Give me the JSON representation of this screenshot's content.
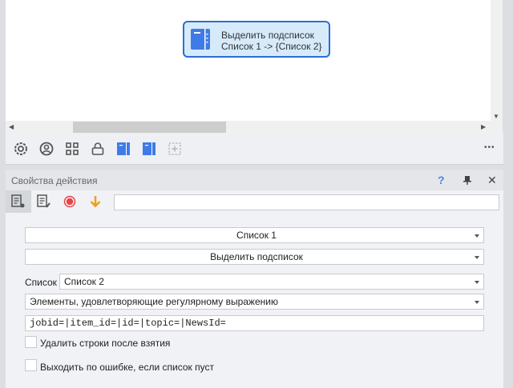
{
  "canvas": {
    "node": {
      "title": "Выделить подсписок",
      "subtitle": "Список 1 -> {Список 2}",
      "color": "#2a6fd4"
    }
  },
  "toolbar": {
    "icons": [
      "gear-icon",
      "user-circle-icon",
      "grid-icon",
      "lock-icon",
      "notebook-icon",
      "notebook-icon",
      "add-dashed-icon"
    ],
    "more": "•••"
  },
  "panel": {
    "title": "Свойства действия",
    "help": "?",
    "pin": "pin-icon",
    "close": "✕",
    "tabs": [
      "properties-icon",
      "edit-icon",
      "record-icon",
      "arrow-down-icon"
    ],
    "search_value": "",
    "source_list": "Список 1",
    "action": "Выделить подсписок",
    "target_label": "Список",
    "target_list": "Список 2",
    "mode": "Элементы, удовлетворяющие регулярному выражению",
    "regex": "jobid=|item_id=|id=|topic=|NewsId=",
    "delete_rows": {
      "label": "Удалить строки после взятия",
      "checked": false
    },
    "exit_on_error": {
      "label": "Выходить по ошибке, если список пуст",
      "checked": false
    }
  }
}
